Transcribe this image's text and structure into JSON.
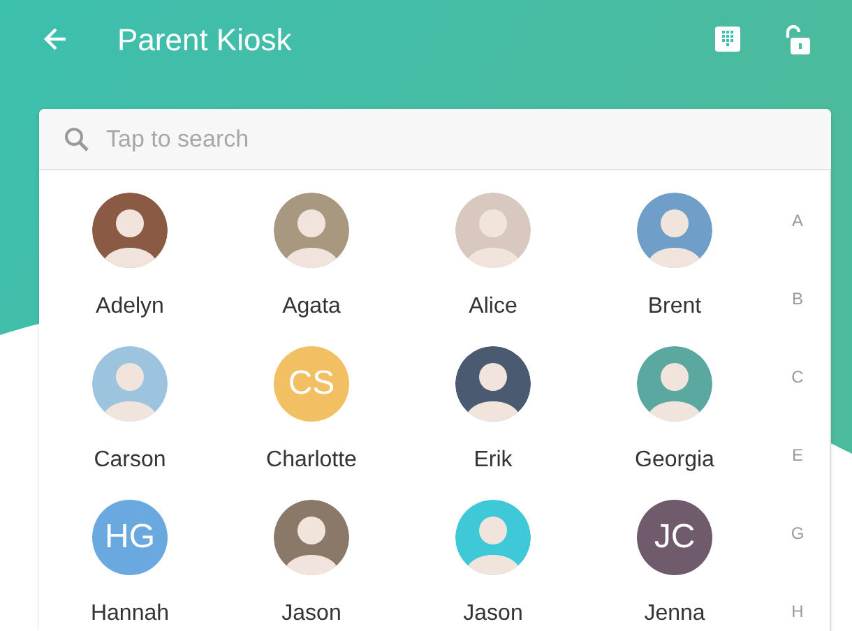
{
  "header": {
    "title": "Parent Kiosk"
  },
  "search": {
    "placeholder": "Tap to search"
  },
  "people": [
    {
      "name": "Adelyn",
      "kind": "photo",
      "color": "#8a5a44"
    },
    {
      "name": "Agata",
      "kind": "photo",
      "color": "#a89880"
    },
    {
      "name": "Alice",
      "kind": "photo",
      "color": "#d8c8c0"
    },
    {
      "name": "Brent",
      "kind": "photo",
      "color": "#6f9fc8"
    },
    {
      "name": "Carson",
      "kind": "photo",
      "color": "#9cc4de"
    },
    {
      "name": "Charlotte",
      "kind": "initials",
      "initials": "CS",
      "color": "#f2c063"
    },
    {
      "name": "Erik",
      "kind": "photo",
      "color": "#4a5a70"
    },
    {
      "name": "Georgia",
      "kind": "photo",
      "color": "#5aa8a0"
    },
    {
      "name": "Hannah",
      "kind": "initials",
      "initials": "HG",
      "color": "#6aa8e0"
    },
    {
      "name": "Jason",
      "kind": "photo",
      "color": "#8a7868"
    },
    {
      "name": "Jason",
      "kind": "photo",
      "color": "#3ec8d8"
    },
    {
      "name": "Jenna",
      "kind": "initials",
      "initials": "JC",
      "color": "#6f5b6b"
    }
  ],
  "index_letters": [
    "A",
    "B",
    "C",
    "E",
    "G",
    "H"
  ]
}
